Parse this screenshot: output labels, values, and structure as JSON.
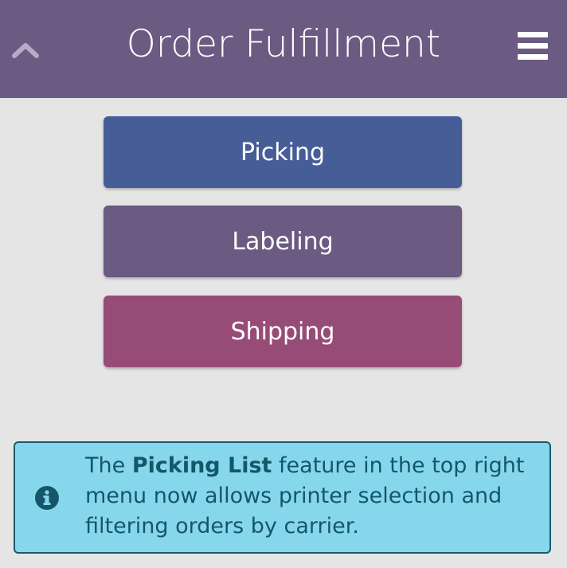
{
  "header": {
    "title": "Order Fulfillment",
    "up_icon": "chevron-up-icon",
    "menu_icon": "hamburger-menu-icon",
    "background": "#6b5a81"
  },
  "actions": [
    {
      "label": "Picking",
      "color": "#475d97"
    },
    {
      "label": "Labeling",
      "color": "#6b5a81"
    },
    {
      "label": "Shipping",
      "color": "#974b77"
    }
  ],
  "notice": {
    "icon": "info-icon",
    "text_before": "The ",
    "highlight": "Picking List",
    "text_after": " feature in the top right menu now allows printer selection and filtering orders by carrier.",
    "background": "#87d7ec",
    "text_color": "#145769"
  }
}
